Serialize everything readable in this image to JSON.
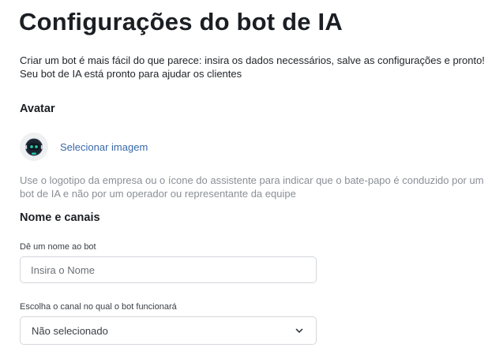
{
  "page": {
    "title": "Configurações do bot de IA",
    "intro_line1": "Criar um bot é mais fácil do que parece: insira os dados necessários, salve as configurações e pronto!",
    "intro_line2": "Seu bot de IA está pronto para ajudar os clientes"
  },
  "avatar_section": {
    "title": "Avatar",
    "select_image_label": "Selecionar imagem",
    "help_line1": "Use o logotipo da empresa ou o ícone do assistente para indicar que o bate-papo é conduzido por um",
    "help_line2": "bot de IA e não por um operador ou representante da equipe",
    "avatar_icon": "robot-icon"
  },
  "name_channels_section": {
    "title": "Nome e canais",
    "name_field": {
      "label": "Dê um nome ao bot",
      "placeholder": "Insira o Nome",
      "value": ""
    },
    "channel_field": {
      "label": "Escolha o canal no qual o bot funcionará",
      "selected": "Não selecionado",
      "icon": "chevron-down-icon"
    }
  },
  "colors": {
    "link": "#3a69a8",
    "muted_text": "#8a8f96",
    "border": "#d3d7dc",
    "avatar_accent": "#22c7a9"
  }
}
